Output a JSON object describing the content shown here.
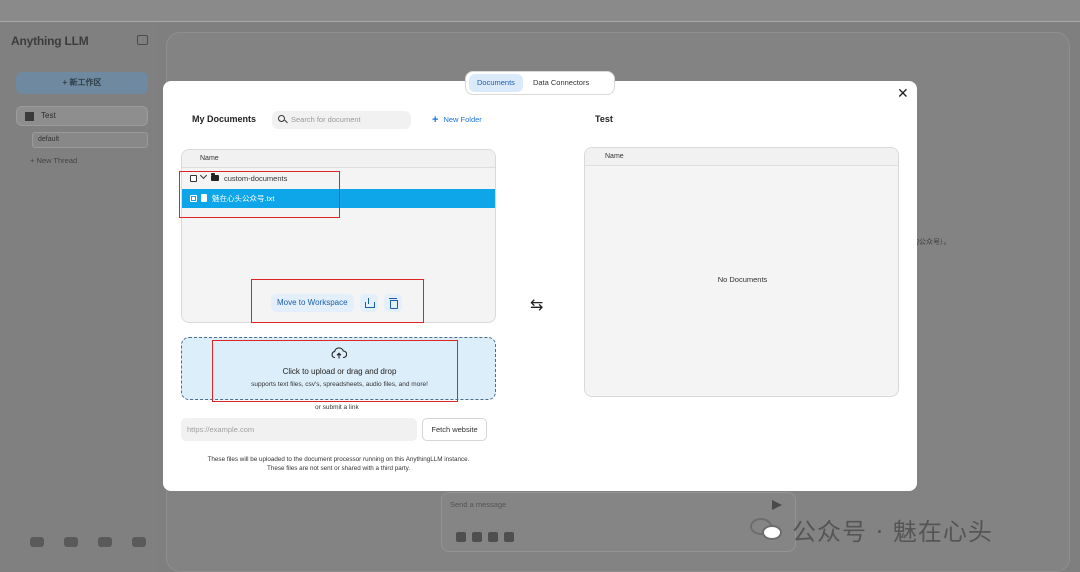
{
  "app": {
    "logo": "Anything LLM",
    "new_workspace_label": "+ 新工作区",
    "workspace_name": "Test",
    "thread_name": "default",
    "new_thread_label": "+ New Thread",
    "chat_placeholder": "Send a message",
    "side_peek_text": "的公众号）。"
  },
  "modal": {
    "tabs": [
      {
        "label": "Documents",
        "active": true
      },
      {
        "label": "Data Connectors",
        "active": false
      }
    ],
    "close_icon": "close-icon",
    "left": {
      "title": "My Documents",
      "search_placeholder": "Search for document",
      "new_folder_label": "New Folder",
      "column_name": "Name",
      "folder": {
        "name": "custom-documents",
        "expanded": true,
        "checked": false
      },
      "file": {
        "name": "魅在心头公众号.txt",
        "selected": true
      },
      "actions": {
        "move_label": "Move to Workspace",
        "upload_icon": "move-upload-icon",
        "delete_icon": "trash-icon"
      }
    },
    "swap_icon": "swap-arrows-icon",
    "right": {
      "title": "Test",
      "column_name": "Name",
      "empty_text": "No Documents"
    },
    "upload": {
      "title": "Click to upload or drag and drop",
      "subtitle": "supports text files, csv's, spreadsheets, audio files, and more!",
      "or_link": "or submit a link",
      "url_placeholder": "https://example.com",
      "fetch_label": "Fetch website",
      "note_line1": "These files will be uploaded to the document processor running on this AnythingLLM instance.",
      "note_line2": "These files are not sent or shared with a third party."
    }
  },
  "watermark": {
    "text": "公众号 · 魅在心头"
  },
  "colors": {
    "accent": "#0ea5e9",
    "highlight_red": "#e02424",
    "tab_active_bg": "#dbeafa",
    "link_blue": "#1c74d8"
  }
}
